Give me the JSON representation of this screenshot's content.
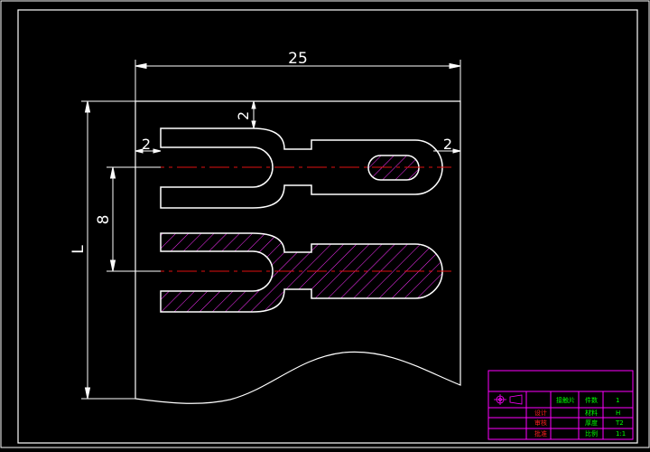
{
  "colors": {
    "background": "#000000",
    "outline": "#ffffff",
    "centerline": "#e01010",
    "hatch": "#ff30ff",
    "title_block": "#ff00ff",
    "title_text": "#00ff00"
  },
  "dimensions": {
    "width_total": "25",
    "tab_top": "2",
    "left_margin": "2",
    "right_margin": "2",
    "pitch": "8",
    "length": "L"
  },
  "title_block": {
    "part_name": "接触片",
    "lbl_count": "件数",
    "val_count": "1",
    "lbl_material": "材料",
    "val_material": "H",
    "lbl_thickness": "厚度",
    "val_thickness": "T2",
    "lbl_scale": "比例",
    "val_scale": "1:1",
    "lbl_design": "设计",
    "lbl_check": "审核",
    "lbl_approve": "批准"
  }
}
